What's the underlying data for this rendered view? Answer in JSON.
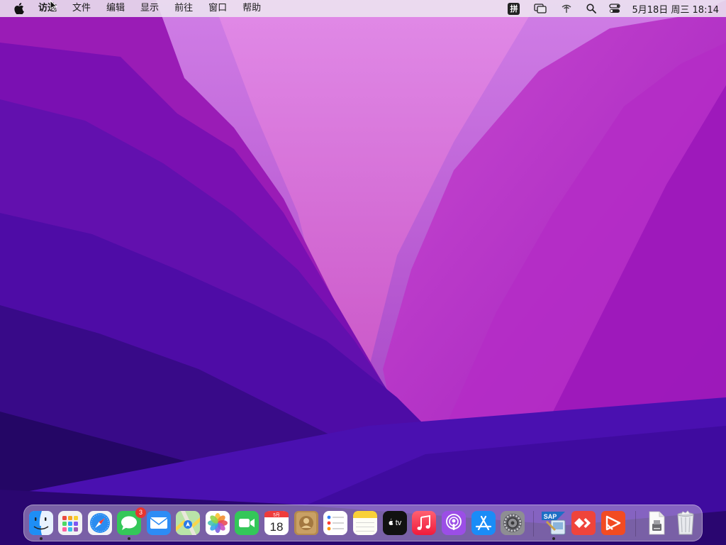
{
  "menubar": {
    "app_name": "访达",
    "menus": [
      "文件",
      "编辑",
      "显示",
      "前往",
      "窗口",
      "帮助"
    ],
    "input_method": "拼",
    "clock": "5月18日 周三  18:14"
  },
  "dock": {
    "apps": [
      {
        "name": "Finder",
        "icon": "finder-icon",
        "running": true
      },
      {
        "name": "Launchpad",
        "icon": "launchpad-icon"
      },
      {
        "name": "Safari",
        "icon": "safari-icon"
      },
      {
        "name": "Messages",
        "icon": "messages-icon",
        "badge": "3",
        "running": true
      },
      {
        "name": "Mail",
        "icon": "mail-icon"
      },
      {
        "name": "Maps",
        "icon": "maps-icon"
      },
      {
        "name": "Photos",
        "icon": "photos-icon"
      },
      {
        "name": "FaceTime",
        "icon": "facetime-icon"
      },
      {
        "name": "Calendar",
        "icon": "calendar-icon",
        "month": "5月",
        "day": "18"
      },
      {
        "name": "Contacts",
        "icon": "contacts-icon"
      },
      {
        "name": "Reminders",
        "icon": "reminders-icon"
      },
      {
        "name": "Notes",
        "icon": "notes-icon"
      },
      {
        "name": "TV",
        "icon": "apple-tv-icon",
        "label": "tv"
      },
      {
        "name": "Music",
        "icon": "music-icon"
      },
      {
        "name": "Podcasts",
        "icon": "podcasts-icon"
      },
      {
        "name": "App Store",
        "icon": "app-store-icon"
      },
      {
        "name": "System Preferences",
        "icon": "system-preferences-icon"
      }
    ],
    "recent_apps": [
      {
        "name": "SAP GUI",
        "icon": "sap-gui-icon",
        "label": "SAP",
        "running": true
      },
      {
        "name": "AnyDesk",
        "icon": "anydesk-icon"
      },
      {
        "name": "Kingsoft Presentation",
        "icon": "presentation-app-icon"
      }
    ],
    "stack_items": [
      {
        "name": "Downloads",
        "icon": "downloads-stack-icon"
      },
      {
        "name": "Trash",
        "icon": "trash-icon"
      }
    ]
  },
  "colors": {
    "wallpaper_top": "#c46ee0",
    "wallpaper_mid": "#7a1fc0",
    "wallpaper_bottom": "#1e0550",
    "badge": "#e8352f"
  }
}
